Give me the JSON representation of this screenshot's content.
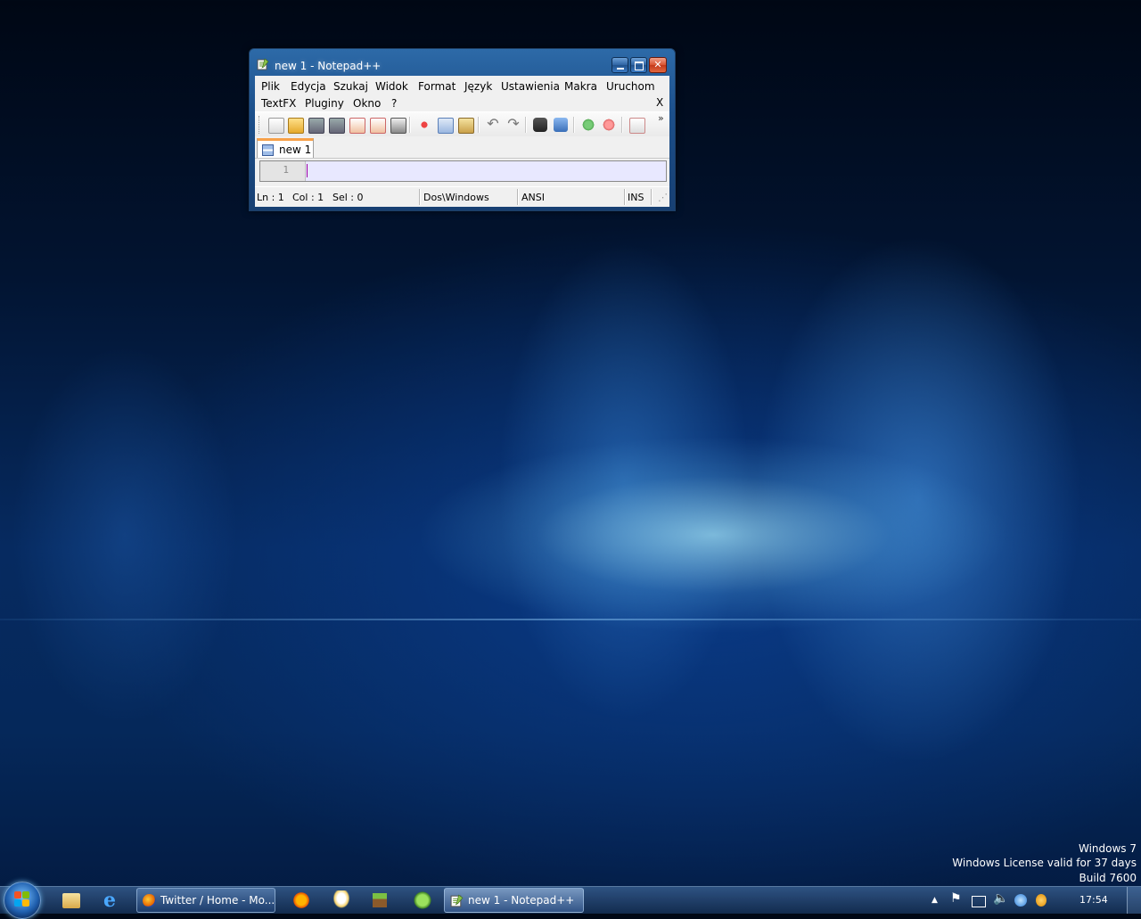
{
  "window": {
    "title": "new 1 - Notepad++",
    "minimize_label": "",
    "maximize_label": "",
    "close_label": "✕",
    "menu": {
      "items": [
        "Plik",
        "Edycja",
        "Szukaj",
        "Widok",
        "Format",
        "Język",
        "Ustawienia",
        "Makra",
        "Uruchom",
        "TextFX",
        "Pluginy",
        "Okno",
        "?"
      ],
      "close_doc": "X"
    },
    "toolbar": {
      "buttons": [
        "new-file-icon",
        "open-file-icon",
        "save-icon",
        "save-all-icon",
        "close-icon",
        "close-all-icon",
        "print-icon",
        "cut-icon",
        "copy-icon",
        "paste-icon",
        "undo-icon",
        "redo-icon",
        "find-icon",
        "replace-icon",
        "zoom-in-icon",
        "zoom-out-icon",
        "sync-scroll-icon"
      ],
      "overflow": "»"
    },
    "tab": {
      "label": "new 1"
    },
    "editor": {
      "line_number": "1"
    },
    "status": {
      "ln": "Ln : 1",
      "col": "Col : 1",
      "sel": "Sel : 0",
      "eol": "Dos\\Windows",
      "encoding": "ANSI",
      "mode": "INS"
    }
  },
  "watermark": {
    "line1": "Windows 7",
    "line2": "Windows License valid for 37 days",
    "line3": "Build 7600"
  },
  "taskbar": {
    "tasks": [
      {
        "label": "Twitter / Home - Mo..."
      },
      {
        "label": "new 1 - Notepad++"
      }
    ],
    "tray_expand": "▲",
    "clock": "17:54"
  },
  "colors": {
    "title_bar": "#1c4f8a",
    "tab_accent": "#f7a14a",
    "editor_bg": "#e8e8ff"
  }
}
